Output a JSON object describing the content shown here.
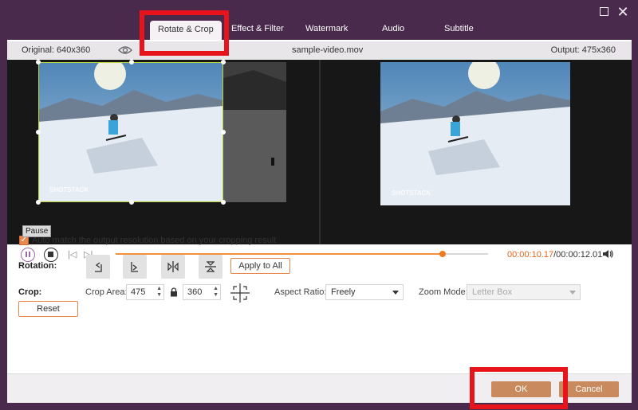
{
  "tabs": [
    {
      "label": "Rotate & Crop",
      "active": true
    },
    {
      "label": "Effect & Filter"
    },
    {
      "label": "Watermark"
    },
    {
      "label": "Audio"
    },
    {
      "label": "Subtitle"
    }
  ],
  "info": {
    "original": "Original: 640x360",
    "filename": "sample-video.mov",
    "output": "Output: 475x360"
  },
  "playback": {
    "current_time": "00:00:10.17",
    "total_time": "/00:00:12.01",
    "progress": 0.878,
    "tooltip": "Pause"
  },
  "options": {
    "auto_match_label": "Auto match the output resolution based on your cropping result",
    "auto_match_checked": true,
    "rotation_label": "Rotation:",
    "apply_to_all": "Apply to All",
    "crop_label": "Crop:",
    "crop_area_label": "Crop Area:",
    "crop_width": "475",
    "crop_height": "360",
    "aspect_ratio_label": "Aspect Ratio:",
    "aspect_ratio_value": "Freely",
    "zoom_mode_label": "Zoom Mode:",
    "zoom_mode_value": "Letter Box",
    "reset": "Reset"
  },
  "footer": {
    "ok": "OK",
    "cancel": "Cancel"
  },
  "colors": {
    "accent": "#e8631a",
    "window_bg": "#4a2a4c",
    "highlight": "#e8141c"
  }
}
